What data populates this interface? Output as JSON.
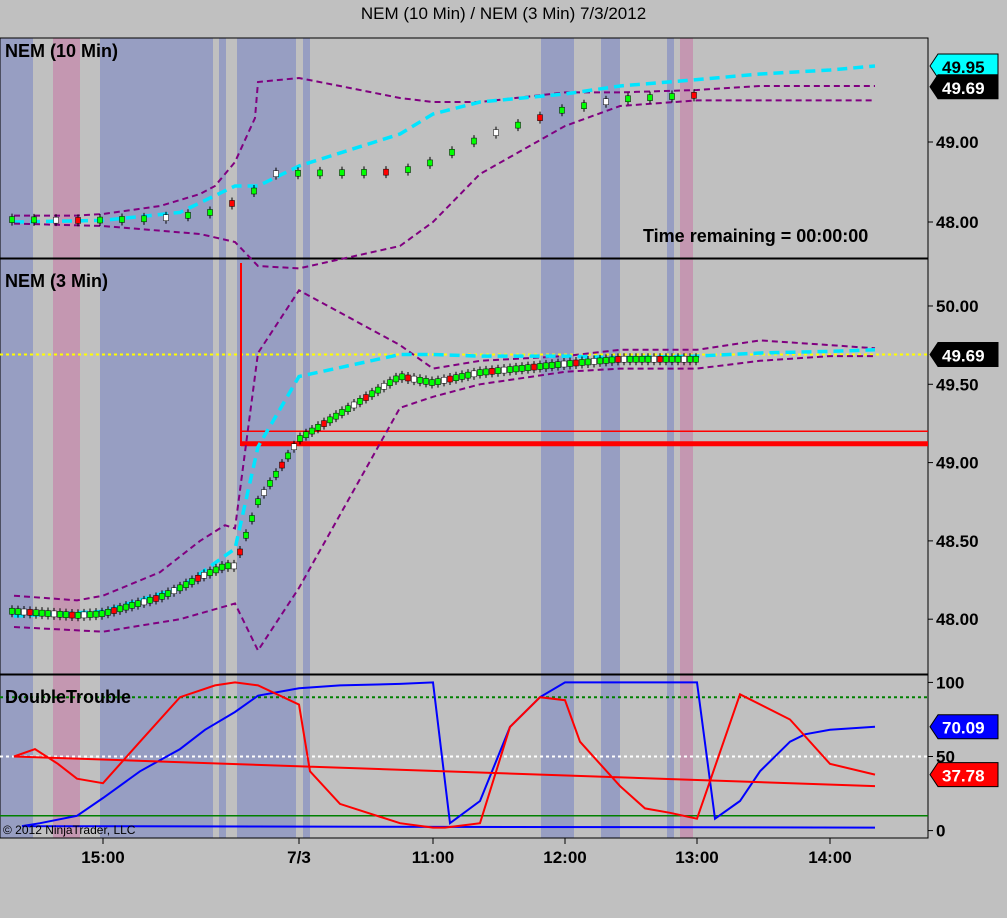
{
  "title": "NEM (10 Min) / NEM (3 Min)  7/3/2012",
  "panels": {
    "top": {
      "label": "NEM (10 Min)",
      "time_remaining": "Time remaining = 00:00:00"
    },
    "middle": {
      "label": "NEM (3 Min)"
    },
    "bottom": {
      "label": "DoubleTrouble",
      "copyright": "© 2012 NinjaTrader, LLC"
    }
  },
  "colors": {
    "background": "#c0c0c0",
    "blue_zone": "#8f98c2",
    "pink_zone": "#c48fae",
    "band": "#800080",
    "average": "#00e5ff",
    "up_bar": "#00ff00",
    "down_bar": "#ff0000",
    "neutral_bar": "#ffffff",
    "dt_blue": "#0000ff",
    "dt_red": "#ff0000"
  },
  "chart_data": [
    {
      "type": "candlestick",
      "panel": "NEM (10 Min)",
      "ylim": [
        47.55,
        50.3
      ],
      "yticks": [
        "49.00",
        "48.00"
      ],
      "price_markers": [
        {
          "value": "49.95",
          "color": "#00ffff"
        },
        {
          "value": "49.69",
          "color": "#000000"
        }
      ],
      "series": [
        {
          "name": "",
          "style": "bollinger-band upper",
          "x": [
            "14:25",
            "14:50",
            "15:00",
            "15:25",
            "15:40",
            "15:50",
            "16:00",
            "16:08",
            "7/3 open",
            "7/3",
            "10:00",
            "10:30",
            "11:00",
            "11:30",
            "12:00",
            "12:30",
            "13:00",
            "13:30",
            "14:00",
            "14:20"
          ],
          "values": [
            48.08,
            48.08,
            48.1,
            48.2,
            48.35,
            48.45,
            48.75,
            49.3,
            49.75,
            49.8,
            49.7,
            49.55,
            49.5,
            49.5,
            49.62,
            49.62,
            49.65,
            49.7,
            49.7,
            49.7
          ]
        },
        {
          "name": "",
          "style": "average",
          "x": [
            "14:25",
            "15:00",
            "15:30",
            "16:00",
            "7/3 open",
            "7/3",
            "10:30",
            "11:00",
            "11:30",
            "12:00",
            "12:30",
            "13:00",
            "13:30",
            "14:00",
            "14:20"
          ],
          "values": [
            48.0,
            48.02,
            48.12,
            48.45,
            48.45,
            48.7,
            49.1,
            49.35,
            49.5,
            49.6,
            49.7,
            49.78,
            49.85,
            49.9,
            49.95
          ]
        },
        {
          "name": "",
          "style": "bollinger-band lower",
          "x": [
            "14:25",
            "15:00",
            "15:40",
            "16:00",
            "7/3 open",
            "7/3",
            "10:30",
            "11:00",
            "11:30",
            "12:00",
            "12:30",
            "13:00",
            "13:30",
            "14:00",
            "14:20"
          ],
          "values": [
            47.98,
            47.95,
            47.85,
            47.75,
            47.45,
            47.42,
            47.7,
            48.0,
            48.6,
            49.2,
            49.45,
            49.52,
            49.52,
            49.52,
            49.52
          ]
        }
      ]
    },
    {
      "type": "candlestick",
      "panel": "NEM (3 Min)",
      "ylim": [
        47.65,
        50.3
      ],
      "yticks": [
        "50.00",
        "49.50",
        "49.00",
        "48.50",
        "48.00"
      ],
      "price_markers": [
        {
          "value": "49.69",
          "color": "#000000"
        }
      ],
      "reference_lines": [
        {
          "value": 49.69,
          "color": "#ffff00",
          "style": "dotted"
        },
        {
          "value": 49.2,
          "color": "#ff0000",
          "style": "thin"
        },
        {
          "value": 49.12,
          "color": "#ff0000",
          "style": "thick"
        }
      ],
      "series": [
        {
          "name": "",
          "style": "bollinger-band upper",
          "x": [
            "14:25",
            "14:50",
            "15:00",
            "15:25",
            "15:40",
            "15:55",
            "16:00",
            "7/3 open",
            "7/3",
            "10:30",
            "11:00",
            "11:30",
            "12:00",
            "12:30",
            "13:00",
            "13:30",
            "14:00",
            "14:20"
          ],
          "values": [
            48.15,
            48.12,
            48.15,
            48.3,
            48.5,
            48.6,
            48.58,
            49.7,
            50.1,
            49.75,
            49.6,
            49.65,
            49.68,
            49.72,
            49.72,
            49.78,
            49.75,
            49.73
          ]
        },
        {
          "name": "",
          "style": "average",
          "x": [
            "14:25",
            "15:00",
            "15:30",
            "16:00",
            "7/3 open",
            "7/3",
            "10:30",
            "11:00",
            "11:30",
            "12:00",
            "12:30",
            "13:00",
            "13:30",
            "14:00",
            "14:20"
          ],
          "values": [
            48.02,
            48.05,
            48.2,
            48.45,
            49.1,
            49.55,
            49.69,
            49.69,
            49.68,
            49.68,
            49.67,
            49.68,
            49.7,
            49.71,
            49.72
          ]
        },
        {
          "name": "",
          "style": "bollinger-band lower",
          "x": [
            "14:25",
            "15:00",
            "15:30",
            "16:00",
            "7/3 open",
            "7/3",
            "10:30",
            "11:00",
            "11:30",
            "12:00",
            "12:30",
            "13:00",
            "13:30",
            "14:00",
            "14:20"
          ],
          "values": [
            47.95,
            47.92,
            48.0,
            48.1,
            47.8,
            48.2,
            49.35,
            49.42,
            49.5,
            49.58,
            49.6,
            49.6,
            49.65,
            49.68,
            49.68
          ]
        }
      ]
    },
    {
      "type": "line",
      "panel": "DoubleTrouble",
      "ylim": [
        -5,
        105
      ],
      "yticks": [
        "100",
        "50",
        "0"
      ],
      "reference_lines": [
        {
          "value": 90,
          "color": "#008000",
          "style": "dotted"
        },
        {
          "value": 50,
          "color": "#ffffff",
          "style": "dotted"
        },
        {
          "value": 10,
          "color": "#008000",
          "style": "thin"
        }
      ],
      "price_markers": [
        {
          "value": "70.09",
          "color": "#0000ff"
        },
        {
          "value": "37.78",
          "color": "#ff0000"
        }
      ],
      "series": [
        {
          "name": "",
          "color": "#0000ff",
          "x": [
            "14:20",
            "14:30",
            "14:40",
            "14:50",
            "15:00",
            "15:15",
            "15:30",
            "15:45",
            "16:00",
            "7/3 open",
            "7/3",
            "10:00",
            "10:30",
            "11:00",
            "11:10",
            "11:30",
            "11:40",
            "11:50",
            "12:00",
            "12:30",
            "13:00",
            "13:10",
            "13:20",
            "13:30",
            "13:40",
            "13:45",
            "14:00",
            "14:20"
          ],
          "values": [
            2,
            3,
            5,
            10,
            22,
            40,
            55,
            68,
            80,
            91,
            96,
            98,
            99,
            100,
            5,
            20,
            70,
            90,
            100,
            100,
            100,
            8,
            20,
            40,
            60,
            65,
            68,
            70.09
          ]
        },
        {
          "name": "",
          "color": "#ff0000",
          "x": [
            "14:20",
            "14:25",
            "14:35",
            "14:45",
            "14:50",
            "15:00",
            "15:15",
            "15:30",
            "15:50",
            "16:00",
            "7/3 open",
            "7/3",
            "9:45",
            "10:00",
            "10:30",
            "11:00",
            "11:05",
            "11:30",
            "11:40",
            "11:50",
            "12:00",
            "12:10",
            "12:30",
            "12:40",
            "12:50",
            "13:00",
            "13:20",
            "13:40",
            "14:00",
            "14:20"
          ],
          "values": [
            30,
            50,
            55,
            45,
            35,
            32,
            60,
            90,
            98,
            100,
            98,
            85,
            40,
            18,
            5,
            2,
            2,
            5,
            70,
            90,
            88,
            60,
            30,
            15,
            12,
            8,
            92,
            75,
            45,
            37.78
          ]
        }
      ]
    }
  ],
  "x_axis": {
    "ticks": [
      "15:00",
      "7/3",
      "11:00",
      "12:00",
      "13:00",
      "14:00"
    ]
  }
}
